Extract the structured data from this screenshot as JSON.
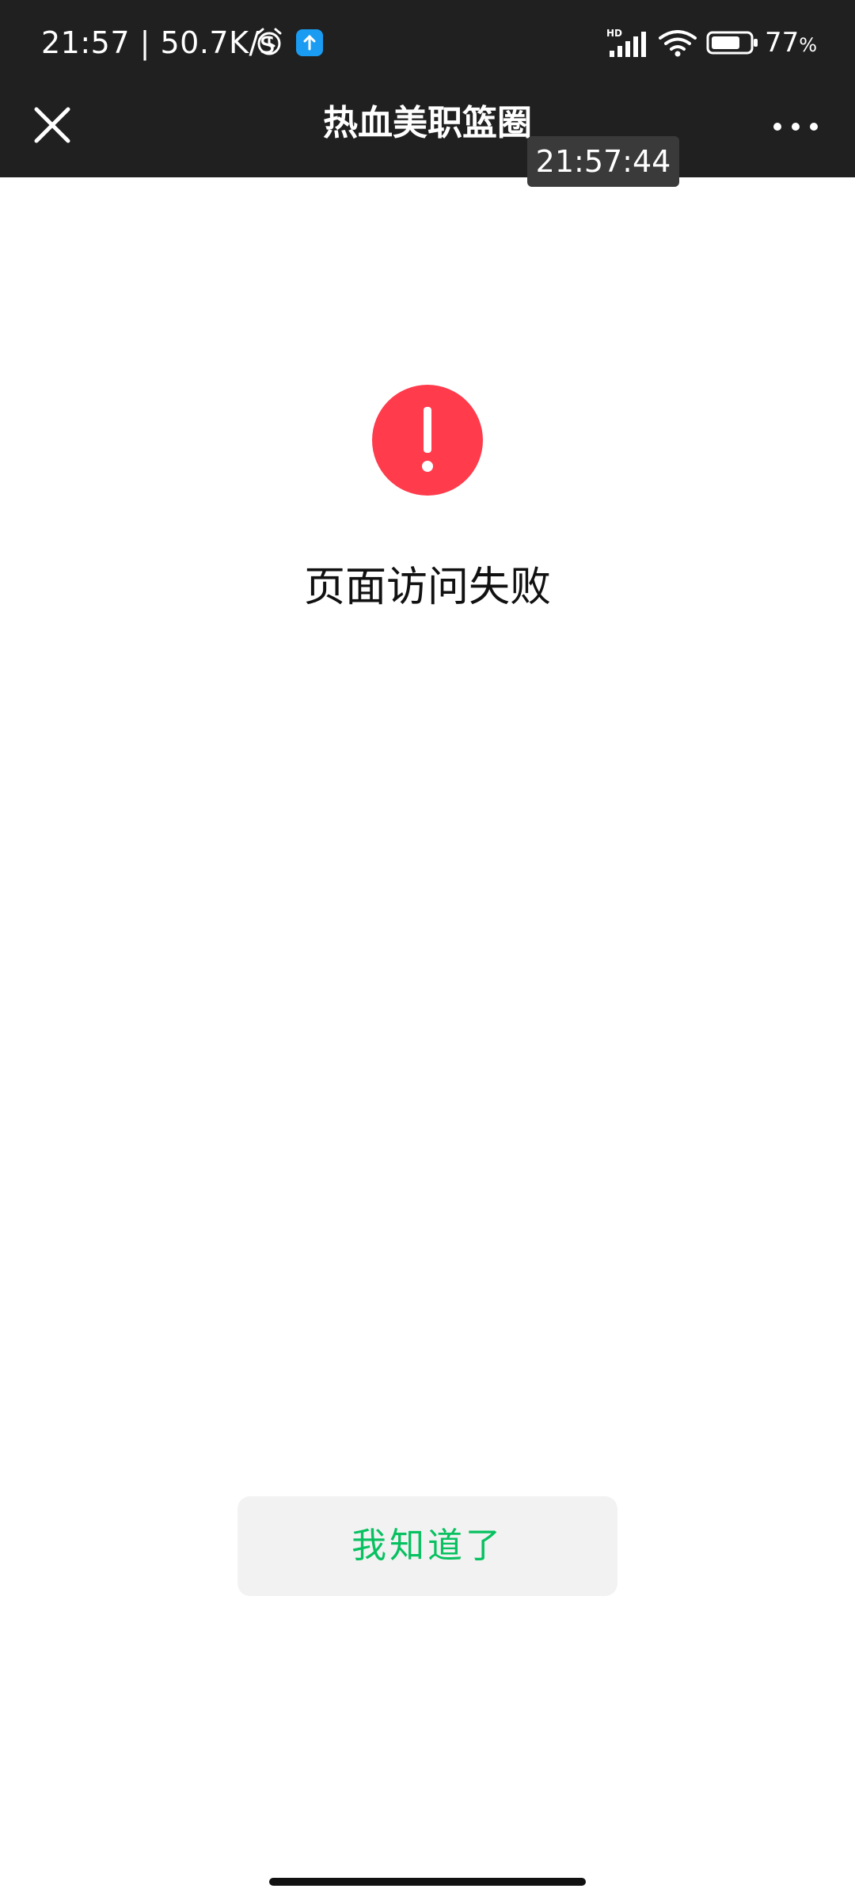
{
  "status_bar": {
    "time_speed": "21:57 | 50.7K/s",
    "signal_label": "HD",
    "battery_percent": "77",
    "battery_sign": "%",
    "battery_level": 0.77,
    "icons": [
      "alarm-icon",
      "upload-app-icon",
      "signal-icon",
      "wifi-icon",
      "battery-icon"
    ]
  },
  "header": {
    "title": "热血美职篮圈",
    "close_icon": "close-icon",
    "more_icon": "more-icon"
  },
  "overlay": {
    "timestamp": "21:57:44"
  },
  "error": {
    "icon": "error-exclamation-icon",
    "message": "页面访问失败"
  },
  "actions": {
    "acknowledge_label": "我知道了"
  },
  "colors": {
    "topbar_bg": "#202020",
    "error_red": "#ff3b4c",
    "accent_green": "#07c160",
    "button_bg": "#f2f2f2"
  }
}
